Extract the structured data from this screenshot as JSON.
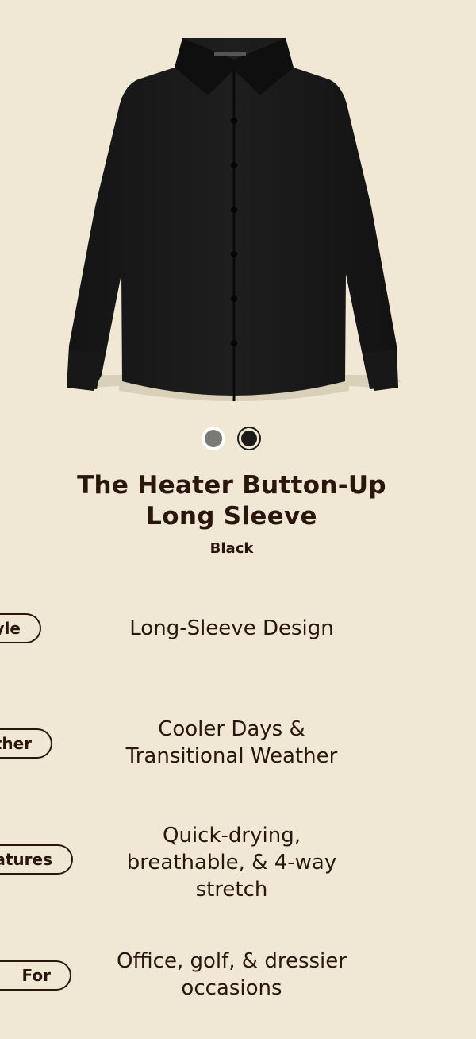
{
  "product": {
    "title": "The Heater Button-Up Long Sleeve",
    "color_name": "Black",
    "image_icon": "shirt-icon"
  },
  "swatches": [
    {
      "label": "Grey",
      "color": "#7a7b77",
      "selected": false
    },
    {
      "label": "Black",
      "color": "#1d1a1a",
      "selected": true
    }
  ],
  "attributes": [
    {
      "label": "Style",
      "visible_label": "yle",
      "value": "Long-Sleeve Design"
    },
    {
      "label": "Weather",
      "visible_label": "ther",
      "value": "Cooler Days & Transitional Weather"
    },
    {
      "label": "Features",
      "visible_label": "atures",
      "value": "Quick-drying, breathable, & 4-way stretch"
    },
    {
      "label": "For",
      "visible_label": "For",
      "value": "Office, golf, & dressier occasions"
    }
  ]
}
